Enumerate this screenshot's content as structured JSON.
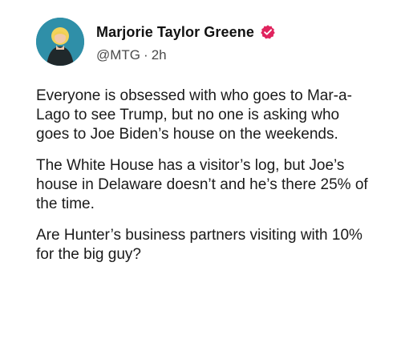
{
  "post": {
    "author": {
      "display_name": "Marjorie Taylor Greene",
      "handle": "@MTG",
      "separator": "·",
      "time": "2h",
      "verified_icon": "verified-badge-icon",
      "verified_color": "#e0245e"
    },
    "body": {
      "paragraphs": [
        "Everyone is obsessed with who goes to Mar-a-Lago to see Trump, but no one is asking who goes to Joe Biden’s house on the weekends.",
        "The White House has a visitor’s log, but Joe’s house in Delaware doesn’t and he’s there 25% of the time.",
        "Are Hunter’s business partners visiting with 10% for the big guy?"
      ]
    }
  }
}
